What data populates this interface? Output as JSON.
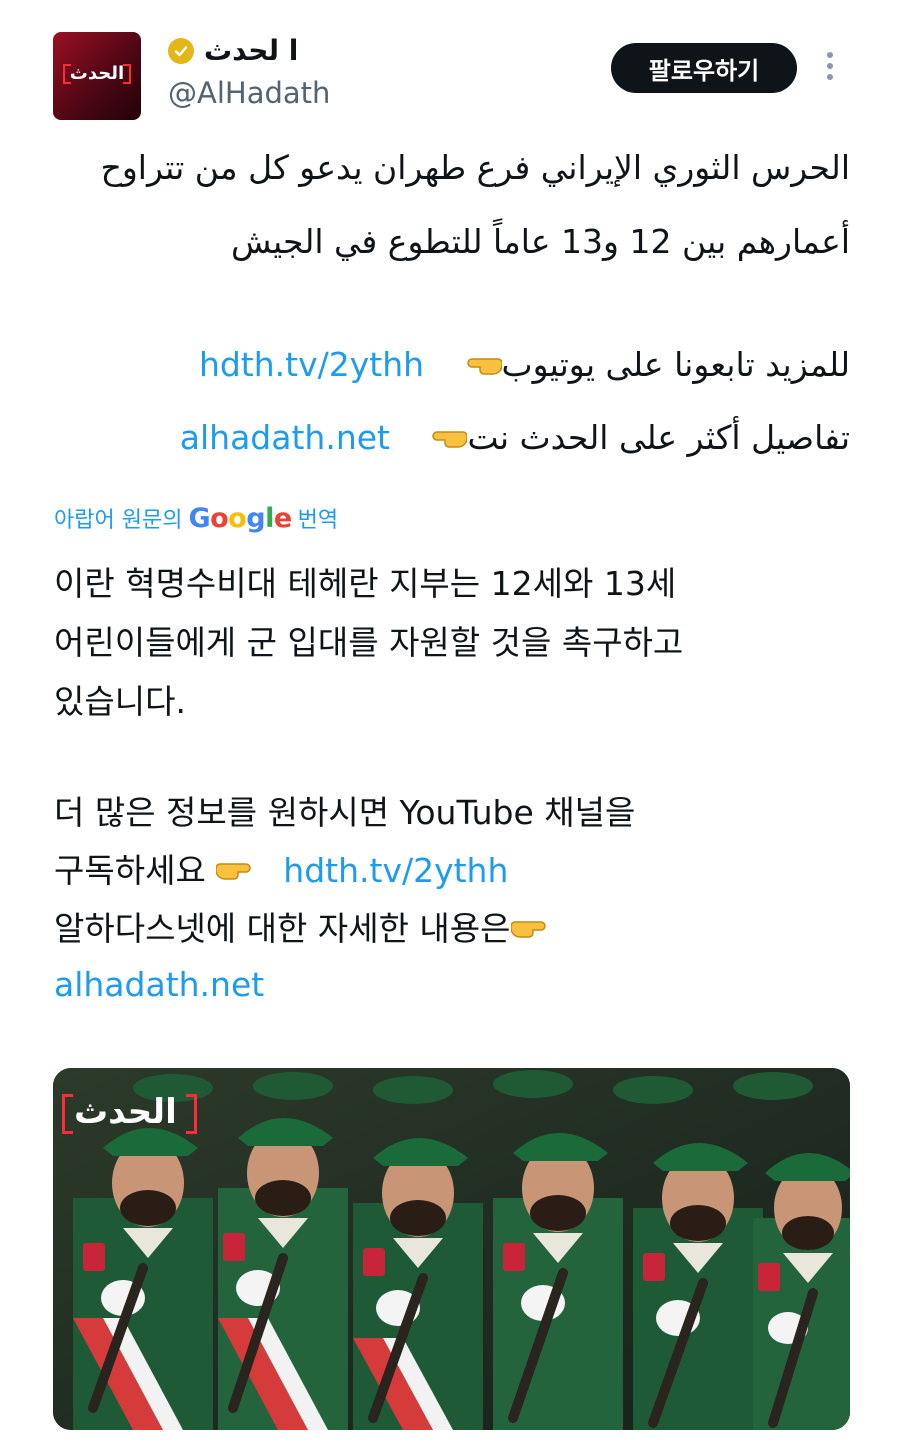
{
  "header": {
    "display_name": "ا لحدث",
    "handle": "@AlHadath",
    "avatar_text": "الحدث",
    "follow_label": "팔로우하기"
  },
  "arabic_body": {
    "line1": "الحرس الثوري الإيراني فرع طهران يدعو كل من تتراوح",
    "line2": "أعمارهم بين 12 و13 عاماً للتطوع في الجيش",
    "youtube_text": "للمزيد تابعونا على يوتيوب",
    "youtube_link": "hdth.tv/2ythh",
    "site_text": "تفاصيل أكثر على الحدث نت",
    "site_link": "alhadath.net"
  },
  "translation": {
    "prefix": "아랍어 원문의",
    "google": "Google",
    "suffix": "번역",
    "line1": "이란 혁명수비대 테헤란 지부는 12세와 13세",
    "line2": "어린이들에게 군 입대를 자원할 것을 촉구하고",
    "line3": "있습니다.",
    "line4": "더 많은 정보를 원하시면 YouTube 채널을",
    "line5_text": "구독하세요",
    "line5_link": "hdth.tv/2ythh",
    "line6": "알하다스넷에 대한 자세한 내용은",
    "line7_link": "alhadath.net"
  },
  "media": {
    "logo_text": "الحدث"
  },
  "colors": {
    "link": "#1d9bf0",
    "text": "#0f1419",
    "secondary": "#536471",
    "brand_red": "#9b0f24",
    "verified_gold": "#e2b719"
  },
  "icons": [
    "verified-badge-icon",
    "more-options-icon",
    "pointing-hand-icon"
  ]
}
